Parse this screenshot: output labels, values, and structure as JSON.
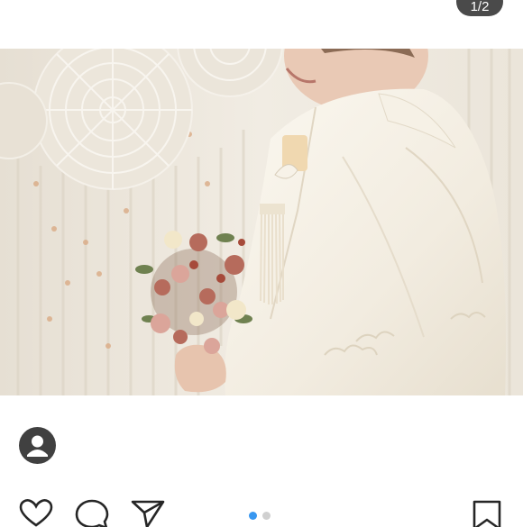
{
  "carousel": {
    "counter_text": "1/2",
    "active_index": 0,
    "total": 2
  },
  "post": {
    "image_alt": "",
    "colors": {
      "accent": "#3897f0",
      "icon": "#262626",
      "avatar_bg": "#404040",
      "dot_inactive": "#d0d0d0"
    }
  },
  "icons": {
    "avatar": "default-user-avatar",
    "like": "heart-outline-icon",
    "comment": "speech-bubble-icon",
    "share": "paper-plane-icon",
    "save": "bookmark-icon"
  }
}
